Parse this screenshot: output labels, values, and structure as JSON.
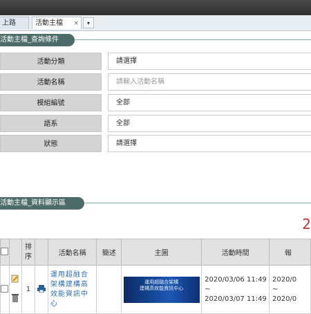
{
  "tabs": [
    {
      "label": "上路"
    },
    {
      "label": "活動主檔",
      "close": "×"
    }
  ],
  "tab_menu_icon": "▾",
  "query_section": {
    "title": "活動主檔_查詢條件",
    "fields": [
      {
        "label": "活動分類",
        "value": "請選擇",
        "is_placeholder": false
      },
      {
        "label": "活動名稱",
        "value": "請輸入活動名稱",
        "is_placeholder": true
      },
      {
        "label": "模組編號",
        "value": "全部",
        "is_placeholder": false
      },
      {
        "label": "語系",
        "value": "全部",
        "is_placeholder": false
      },
      {
        "label": "狀態",
        "value": "請選擇",
        "is_placeholder": false
      }
    ]
  },
  "result_section": {
    "title": "活動主檔_資料顯示區",
    "page_indicator": "2",
    "columns": [
      "",
      "",
      "排序",
      "",
      "活動名稱",
      "簡述",
      "主圖",
      "活動時間",
      "報"
    ],
    "rows": [
      {
        "order": "1",
        "name": "運用超融合架構建構高效能資訊中心",
        "summary": "",
        "banner_text": "運用超融合架構\n建構高效能資訊中心",
        "time_start": "2020/03/06 11:49",
        "time_sep": "~",
        "time_end": "2020/03/07 11:49",
        "extra_start": "2020/0",
        "extra_sep": "~",
        "extra_end": "2020/0"
      }
    ]
  },
  "colors": {
    "section_bg": "#4d6b68",
    "link": "#2f6fb3",
    "page": "#d0312d"
  }
}
